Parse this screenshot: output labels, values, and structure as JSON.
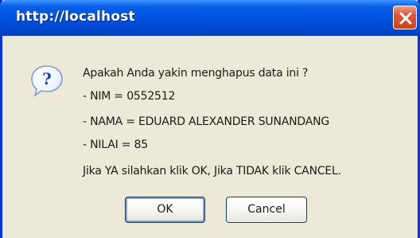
{
  "window": {
    "title": "http://localhost"
  },
  "dialog": {
    "icon": "question-icon",
    "lines": [
      "Apakah Anda yakin menghapus data ini ?",
      "- NIM = 0552512",
      "- NAMA = EDUARD ALEXANDER SUNANDANG",
      "- NILAI = 85",
      "Jika YA silahkan klik OK, Jika TIDAK klik CANCEL."
    ]
  },
  "buttons": {
    "ok_label": "OK",
    "cancel_label": "Cancel"
  },
  "colors": {
    "titlebar": "#0054e3",
    "frame": "#0831d9",
    "dialog_background": "#ece9d8",
    "close_button": "#e0593a"
  }
}
